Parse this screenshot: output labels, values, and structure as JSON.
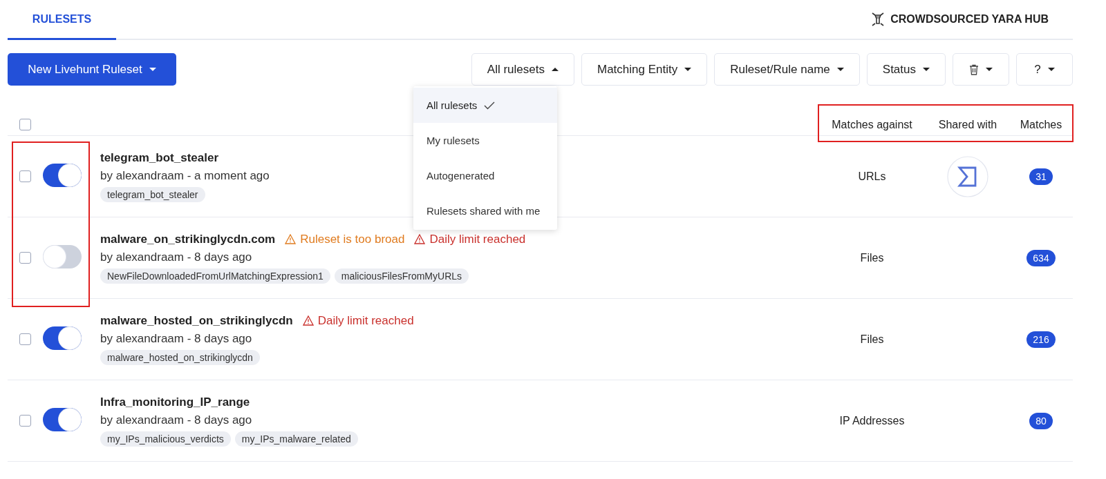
{
  "tabs": [
    {
      "label": "RULESETS",
      "selected": true
    }
  ],
  "brand": {
    "name": "CROWDSOURCED YARA HUB"
  },
  "new_button": {
    "label": "New Livehunt Ruleset"
  },
  "filters": [
    {
      "kind": "text",
      "label": "All rulesets",
      "expanded": true
    },
    {
      "kind": "text",
      "label": "Matching Entity",
      "expanded": false
    },
    {
      "kind": "text",
      "label": "Ruleset/Rule name",
      "expanded": false
    },
    {
      "kind": "text",
      "label": "Status",
      "expanded": false
    },
    {
      "kind": "trash",
      "expanded": false
    },
    {
      "kind": "text",
      "label": "?",
      "expanded": false
    }
  ],
  "filter_menu": {
    "items": [
      {
        "label": "All rulesets",
        "selected": true
      },
      {
        "label": "My rulesets",
        "selected": false
      },
      {
        "label": "Autogenerated",
        "selected": false
      },
      {
        "label": "Rulesets shared with me",
        "selected": false
      }
    ]
  },
  "table": {
    "select_all_checked": false,
    "columns": [
      "Matches against",
      "Shared with",
      "Matches"
    ],
    "rows": [
      {
        "checked": false,
        "enabled": true,
        "name": "telegram_bot_stealer",
        "warnings": [],
        "byline": "by alexandraam - a moment ago",
        "tags": [
          "telegram_bot_stealer"
        ],
        "matches_against": "URLs",
        "shared": true,
        "matches": "31"
      },
      {
        "checked": false,
        "enabled": false,
        "name": "malware_on_strikinglycdn.com",
        "warnings": [
          {
            "kind": "broad",
            "text": "Ruleset is too broad"
          },
          {
            "kind": "limit",
            "text": "Daily limit reached"
          }
        ],
        "byline": "by alexandraam - 8 days ago",
        "tags": [
          "NewFileDownloadedFromUrlMatchingExpression1",
          "maliciousFilesFromMyURLs"
        ],
        "matches_against": "Files",
        "shared": false,
        "matches": "634"
      },
      {
        "checked": false,
        "enabled": true,
        "name": "malware_hosted_on_strikinglycdn",
        "warnings": [
          {
            "kind": "limit",
            "text": "Daily limit reached"
          }
        ],
        "byline": "by alexandraam - 8 days ago",
        "tags": [
          "malware_hosted_on_strikinglycdn"
        ],
        "matches_against": "Files",
        "shared": false,
        "matches": "216"
      },
      {
        "checked": false,
        "enabled": true,
        "name": "Infra_monitoring_IP_range",
        "warnings": [],
        "byline": "by alexandraam - 8 days ago",
        "tags": [
          "my_IPs_malicious_verdicts",
          "my_IPs_malware_related"
        ],
        "matches_against": "IP Addresses",
        "shared": false,
        "matches": "80"
      }
    ]
  }
}
